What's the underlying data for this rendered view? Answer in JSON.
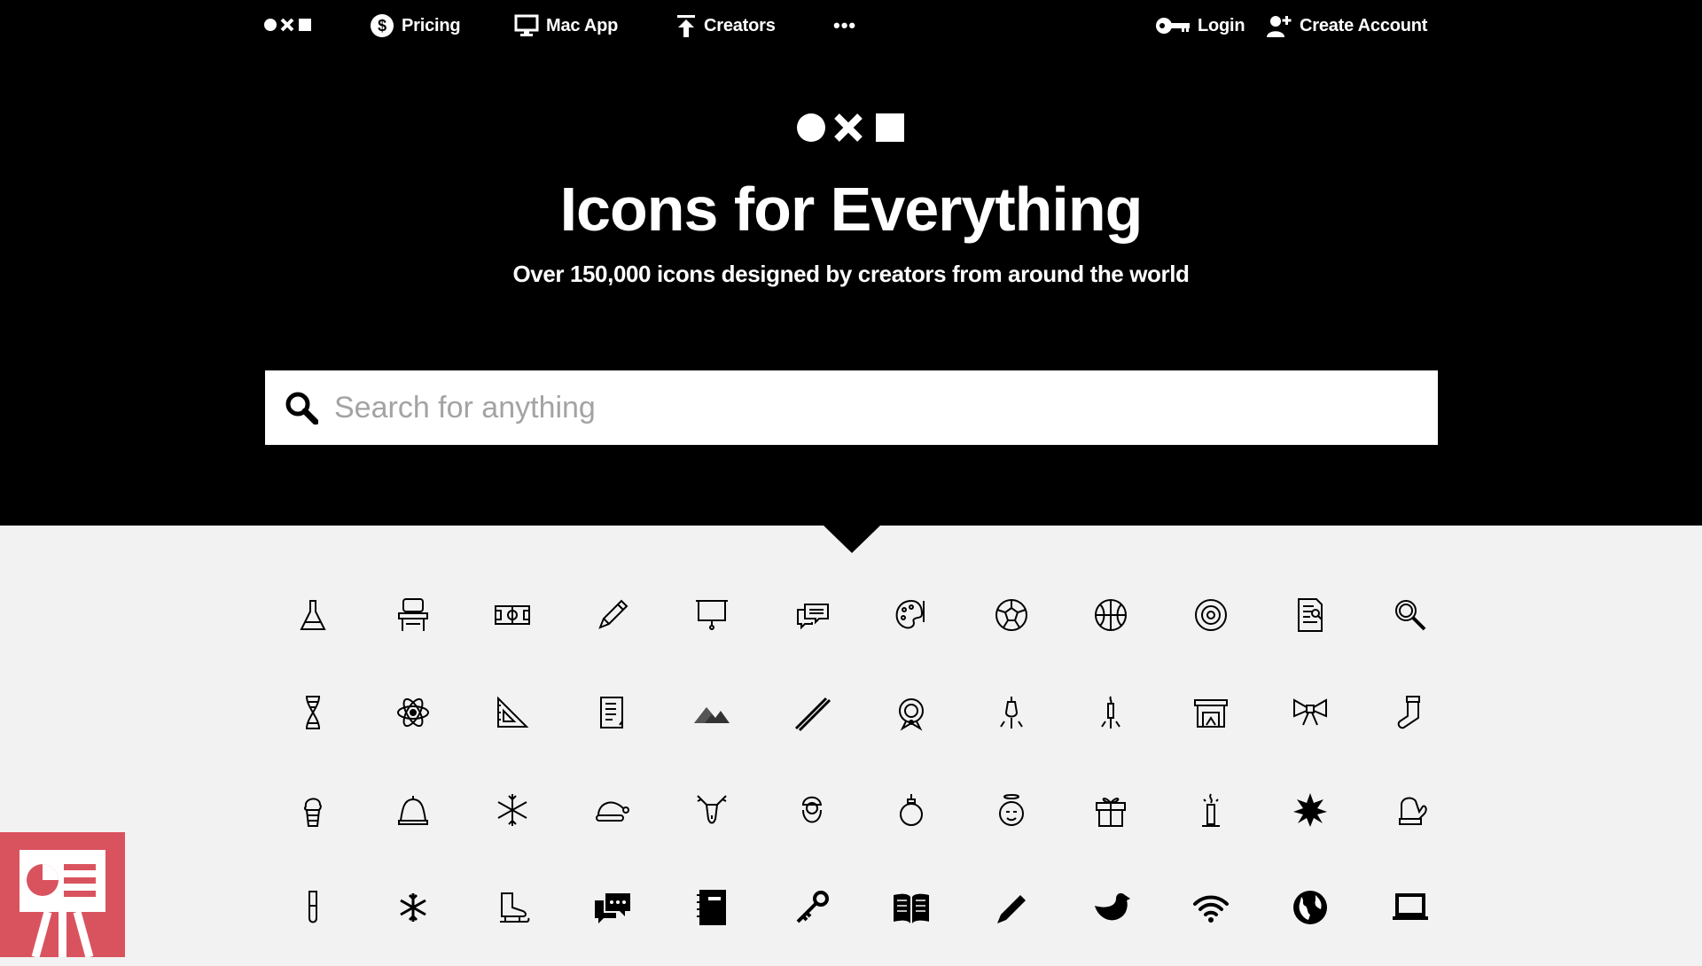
{
  "nav": {
    "pricing": "Pricing",
    "mac_app": "Mac App",
    "creators": "Creators",
    "more": "•••",
    "login": "Login",
    "create_account": "Create Account"
  },
  "hero": {
    "title": "Icons for Everything",
    "subtitle": "Over 150,000 icons designed by creators from around the world"
  },
  "search": {
    "placeholder": "Search for anything"
  },
  "icons": [
    "flask-icon",
    "school-desk-icon",
    "soccer-field-icon",
    "pencil-icon",
    "projector-screen-icon",
    "chat-bubbles-icon",
    "paint-palette-icon",
    "soccer-ball-icon",
    "basketball-icon",
    "target-ring-icon",
    "document-search-icon",
    "magnifier-icon",
    "dna-icon",
    "atom-icon",
    "set-square-icon",
    "notepad-icon",
    "mountains-icon",
    "ruler-icon",
    "christmas-wreath-icon",
    "christmas-lights-icon",
    "candle-icon",
    "fireplace-icon",
    "bow-icon",
    "stocking-icon",
    "ice-cream-icon",
    "bell-icon",
    "snowflake-icon",
    "santa-hat-icon",
    "reindeer-icon",
    "santa-icon",
    "ornament-icon",
    "angel-icon",
    "gift-icon",
    "candle-lit-icon",
    "snowflake-solid-icon",
    "mitten-icon",
    "test-tube-icon",
    "snowflake-small-icon",
    "ice-skate-icon",
    "chat-solid-icon",
    "notebook-icon",
    "key-icon",
    "open-book-icon",
    "pencil-solid-icon",
    "bird-icon",
    "wifi-icon",
    "globe-icon",
    "laptop-icon"
  ],
  "colors": {
    "hero_bg": "#000000",
    "page_bg": "#f2f2f2",
    "badge": "#d9535f"
  }
}
